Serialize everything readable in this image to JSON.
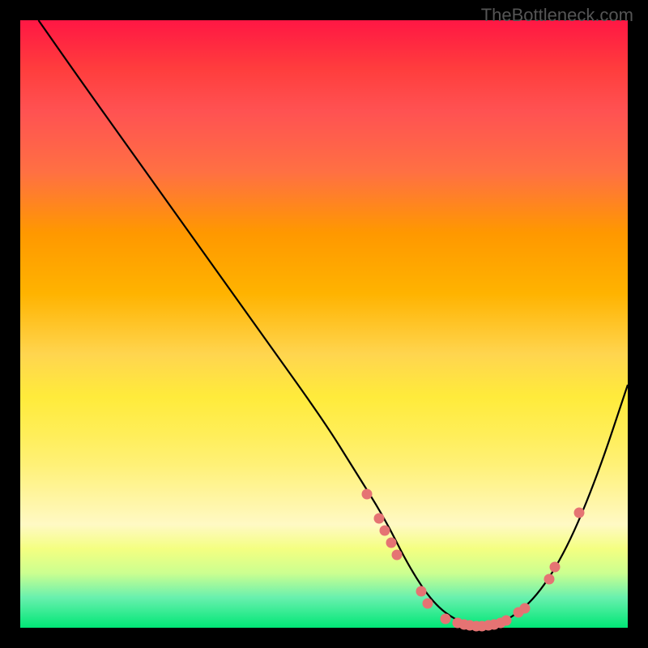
{
  "watermark": "TheBottleneck.com",
  "chart_data": {
    "type": "line",
    "title": "",
    "xlabel": "",
    "ylabel": "",
    "xlim": [
      0,
      100
    ],
    "ylim": [
      0,
      100
    ],
    "series": [
      {
        "name": "curve",
        "x": [
          3,
          10,
          20,
          30,
          40,
          50,
          55,
          60,
          64,
          68,
          72,
          76,
          80,
          85,
          90,
          95,
          100
        ],
        "y": [
          100,
          90,
          76,
          62,
          48,
          34,
          26,
          18,
          10,
          4,
          1,
          0,
          1,
          5,
          13,
          25,
          40
        ]
      }
    ],
    "points": [
      {
        "x": 57,
        "y": 22
      },
      {
        "x": 59,
        "y": 18
      },
      {
        "x": 60,
        "y": 16
      },
      {
        "x": 61,
        "y": 14
      },
      {
        "x": 62,
        "y": 12
      },
      {
        "x": 66,
        "y": 6
      },
      {
        "x": 67,
        "y": 4
      },
      {
        "x": 70,
        "y": 1.5
      },
      {
        "x": 72,
        "y": 0.8
      },
      {
        "x": 73,
        "y": 0.5
      },
      {
        "x": 74,
        "y": 0.4
      },
      {
        "x": 75,
        "y": 0.3
      },
      {
        "x": 76,
        "y": 0.3
      },
      {
        "x": 77,
        "y": 0.4
      },
      {
        "x": 78,
        "y": 0.6
      },
      {
        "x": 79,
        "y": 0.8
      },
      {
        "x": 80,
        "y": 1.2
      },
      {
        "x": 82,
        "y": 2.5
      },
      {
        "x": 83,
        "y": 3.2
      },
      {
        "x": 87,
        "y": 8
      },
      {
        "x": 88,
        "y": 10
      },
      {
        "x": 92,
        "y": 19
      }
    ],
    "gradient_note": "Background vertical gradient red→orange→yellow→green representing severity"
  }
}
